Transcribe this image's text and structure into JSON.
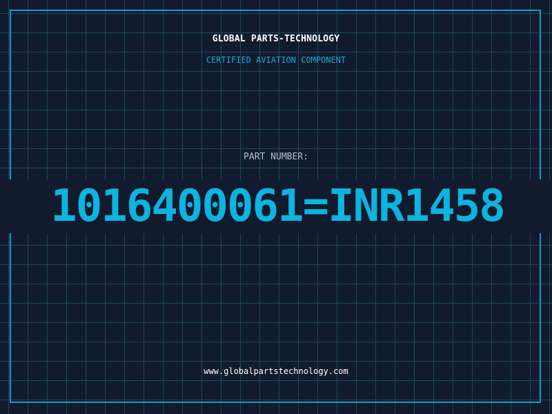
{
  "header": {
    "company": "GLOBAL PARTS-TECHNOLOGY",
    "tagline": "CERTIFIED AVIATION COMPONENT"
  },
  "part": {
    "label": "PART NUMBER:",
    "number": "1016400061=INR1458"
  },
  "footer": {
    "website": "www.globalpartstechnology.com"
  },
  "colors": {
    "background": "#121a2e",
    "grid": "#1c4a5e",
    "frame": "#139fca",
    "accent": "#0cb4df"
  }
}
